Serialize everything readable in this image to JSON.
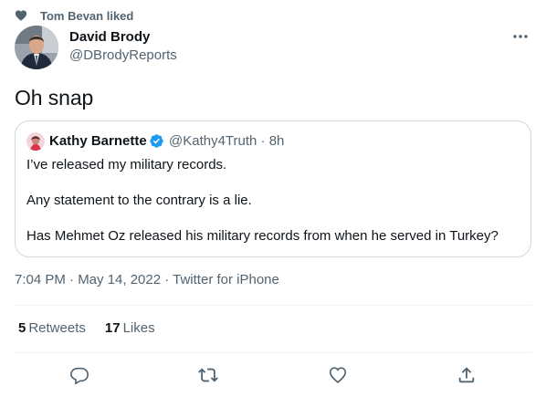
{
  "social_context": {
    "text": "Tom Bevan liked",
    "icon": "heart-icon"
  },
  "author": {
    "name": "David Brody",
    "handle": "@DBrodyReports"
  },
  "tweet": {
    "text": "Oh snap"
  },
  "quoted_tweet": {
    "name": "Kathy Barnette",
    "verified": true,
    "meta": "@Kathy4Truth · 8h",
    "lines": [
      "I’ve released my military records.",
      "Any statement to the contrary is a lie.",
      "Has Mehmet Oz released his military records from when he served in Turkey?"
    ]
  },
  "timestamp": "7:04 PM · May 14, 2022 · Twitter for iPhone",
  "stats": {
    "retweets": {
      "count": "5",
      "label": "Retweets"
    },
    "likes": {
      "count": "17",
      "label": "Likes"
    }
  },
  "actions": [
    "reply-icon",
    "retweet-icon",
    "like-icon",
    "share-icon"
  ],
  "colors": {
    "text": "#0f1419",
    "secondary": "#536471",
    "border": "#cfd9de",
    "divider": "#eff3f4",
    "verified": "#1d9bf0"
  }
}
